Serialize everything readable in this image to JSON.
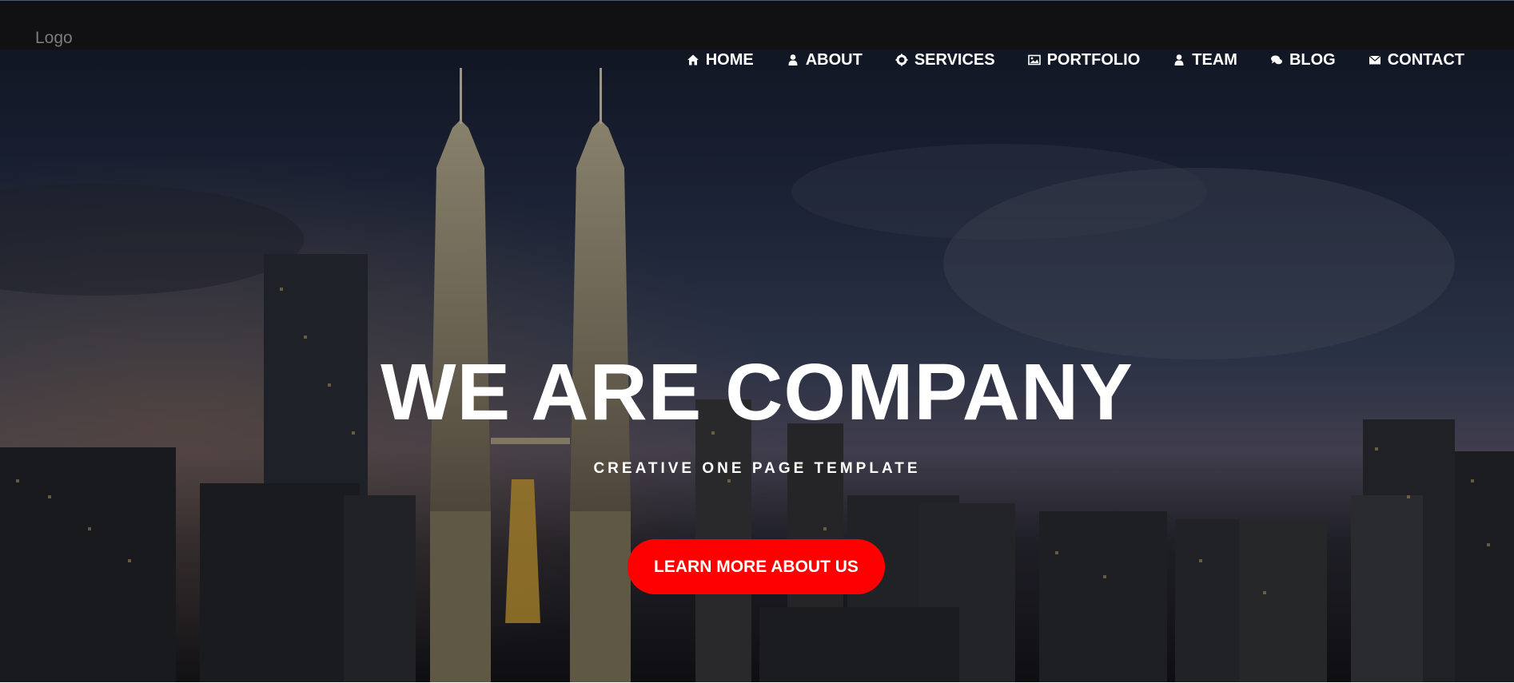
{
  "header": {
    "logo": "Logo"
  },
  "nav": {
    "items": [
      {
        "label": "HOME",
        "icon": "home-icon"
      },
      {
        "label": "ABOUT",
        "icon": "user-icon"
      },
      {
        "label": "SERVICES",
        "icon": "gear-icon"
      },
      {
        "label": "PORTFOLIO",
        "icon": "image-icon"
      },
      {
        "label": "TEAM",
        "icon": "user-icon"
      },
      {
        "label": "BLOG",
        "icon": "comments-icon"
      },
      {
        "label": "CONTACT",
        "icon": "envelope-icon"
      }
    ]
  },
  "hero": {
    "title": "WE ARE COMPANY",
    "subtitle": "CREATIVE ONE PAGE TEMPLATE",
    "cta_label": "LEARN MORE ABOUT US"
  },
  "colors": {
    "accent": "#ff0000",
    "topbar": "#111113",
    "text": "#ffffff"
  }
}
